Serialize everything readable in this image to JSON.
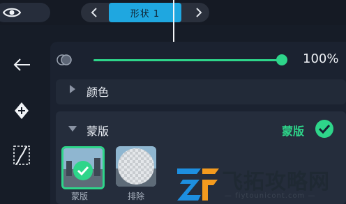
{
  "timeline": {
    "clip_label": "形状 1"
  },
  "opacity": {
    "value_text": "100%",
    "fraction": 1.0
  },
  "sections": {
    "color_label": "颜色",
    "mask_label": "蒙版",
    "mask_toggle_label": "蒙版"
  },
  "mask_options": [
    {
      "label": "蒙版",
      "selected": true
    },
    {
      "label": "排除",
      "selected": false
    }
  ],
  "watermark": {
    "main": "飞拓攻略网",
    "sub": "— fiytounicont.com —"
  },
  "colors": {
    "accent": "#2ed58a",
    "clip": "#1fa7e0",
    "background": "#161c27",
    "panel": "#1b2230"
  },
  "icons": [
    "eye-icon",
    "chevron-left-icon",
    "chevron-right-icon",
    "back-arrow-icon",
    "keyframe-add-icon",
    "curve-icon",
    "opacity-icon",
    "expand-triangle-icon",
    "check-icon"
  ]
}
